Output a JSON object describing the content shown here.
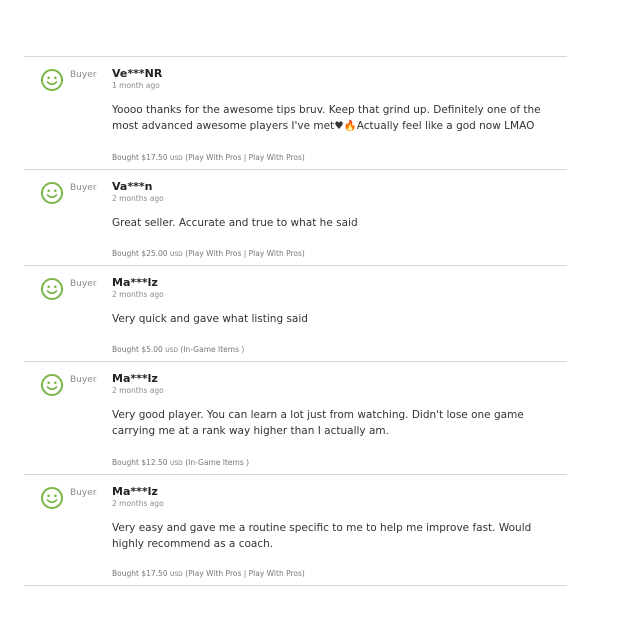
{
  "colors": {
    "accent_green": "#7ab648",
    "divider": "#d6d6d6"
  },
  "icons": {
    "avatar": "smiley-face-icon"
  },
  "reviews": [
    {
      "role": "Buyer",
      "name": "Ve***NR",
      "time": "1 month ago",
      "text": "Yoooo thanks for the awesome tips bruv. Keep that grind up. Definitely one of the most advanced awesome players I've met♥🔥Actually feel like a god now LMAO",
      "bought": "Bought $17.50",
      "currency": "USD",
      "category": "(Play With Pros | Play With Pros)"
    },
    {
      "role": "Buyer",
      "name": "Va***n",
      "time": "2 months ago",
      "text": "Great seller. Accurate and true to what he said",
      "bought": "Bought $25.00",
      "currency": "USD",
      "category": "(Play With Pros | Play With Pros)"
    },
    {
      "role": "Buyer",
      "name": "Ma***lz",
      "time": "2 months ago",
      "text": "Very quick and gave what listing said",
      "bought": "Bought $5.00",
      "currency": "USD",
      "category": "(In-Game Items )"
    },
    {
      "role": "Buyer",
      "name": "Ma***lz",
      "time": "2 months ago",
      "text": "Very good player. You can learn a lot just from watching. Didn't lose one game carrying me at a rank way higher than I actually am.",
      "bought": "Bought $12.50",
      "currency": "USD",
      "category": "(In-Game Items )"
    },
    {
      "role": "Buyer",
      "name": "Ma***lz",
      "time": "2 months ago",
      "text": "Very easy and gave me a routine specific to me to help me improve fast. Would highly recommend as a coach.",
      "bought": "Bought $17.50",
      "currency": "USD",
      "category": "(Play With Pros | Play With Pros)"
    }
  ]
}
